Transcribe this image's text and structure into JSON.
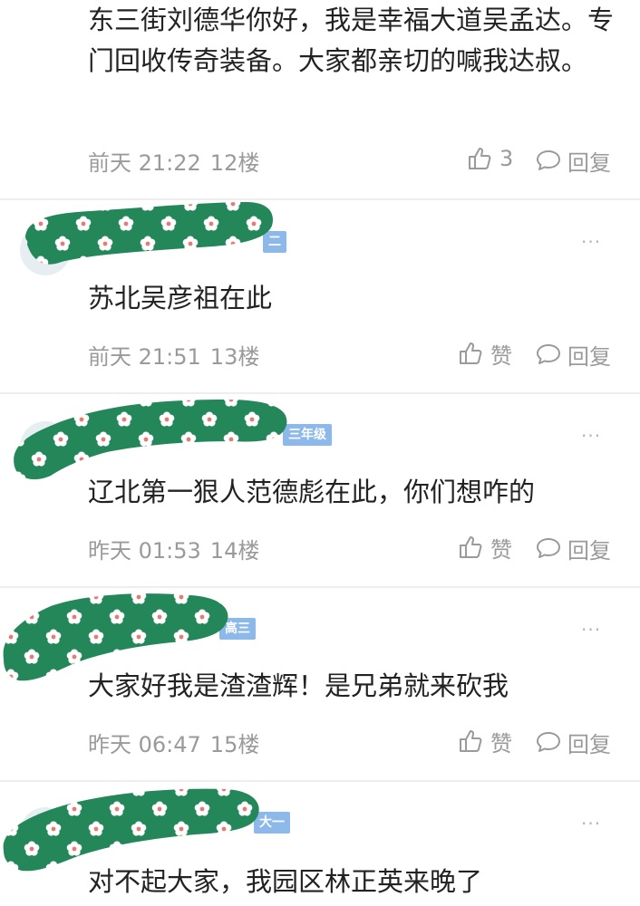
{
  "colors": {
    "text": "#222222",
    "meta": "#9a9a9a",
    "badge": "#8db8ea",
    "divider": "#eeeeee",
    "blob": "#23875a"
  },
  "icons": {
    "like": "thumbs-up-icon",
    "reply": "speech-bubble-icon",
    "more": "more-dots-icon"
  },
  "comments": [
    {
      "text": "东三街刘德华你好，我是幸福大道吴孟达。专门回收传奇装备。大家都亲切的喊我达叔。",
      "date": "前天 21:22",
      "floor": "12楼",
      "like": "3",
      "reply": "回复"
    },
    {
      "badge": "二",
      "text": "苏北吴彦祖在此",
      "date": "前天 21:51",
      "floor": "13楼",
      "like": "赞",
      "reply": "回复",
      "more": "···"
    },
    {
      "badge": "三年级",
      "text": "辽北第一狠人范德彪在此，你们想咋的",
      "date": "昨天 01:53",
      "floor": "14楼",
      "like": "赞",
      "reply": "回复",
      "more": "···"
    },
    {
      "badge": "高三",
      "text": "大家好我是渣渣辉！是兄弟就来砍我",
      "date": "昨天 06:47",
      "floor": "15楼",
      "like": "赞",
      "reply": "回复",
      "more": "···"
    },
    {
      "badge": "大一",
      "text": "对不起大家，我园区林正英来晚了",
      "more": "···"
    }
  ]
}
